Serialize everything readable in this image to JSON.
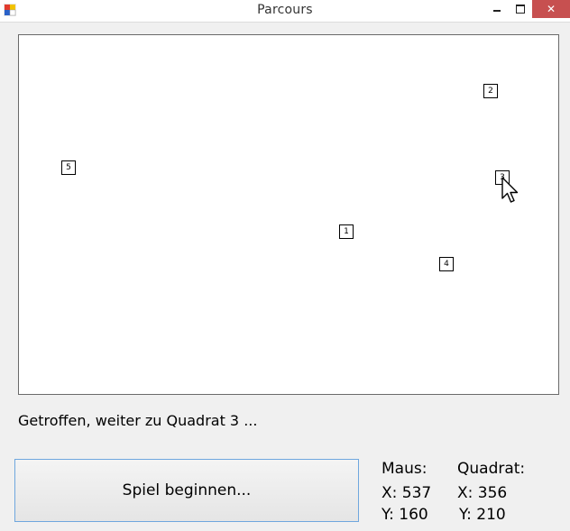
{
  "window": {
    "title": "Parcours",
    "minimize_glyph": "—",
    "close_glyph": "✕"
  },
  "playfield": {
    "squares": [
      {
        "id": "1",
        "label": "1"
      },
      {
        "id": "2",
        "label": "2"
      },
      {
        "id": "3",
        "label": "3"
      },
      {
        "id": "4",
        "label": "4"
      },
      {
        "id": "5",
        "label": "5"
      }
    ]
  },
  "status": {
    "message": "Getroffen, weiter zu Quadrat 3 ..."
  },
  "start_button": {
    "label": "Spiel beginnen..."
  },
  "coords": {
    "mouse_heading": "Maus:",
    "mouse_x": "X: 537",
    "mouse_y": "Y: 160",
    "square_heading": "Quadrat:",
    "square_x": "X: 356",
    "square_y": "Y: 210"
  },
  "icons": [
    "app-icon",
    "minimize-icon",
    "maximize-icon",
    "close-icon",
    "mouse-cursor-icon"
  ]
}
